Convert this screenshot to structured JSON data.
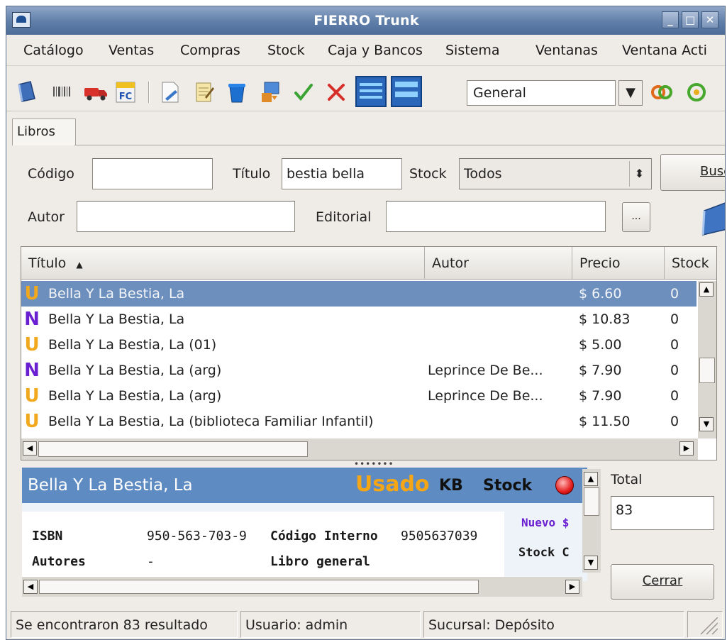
{
  "window": {
    "title": "FIERRO Trunk"
  },
  "menu": [
    "Catálogo",
    "Ventas",
    "Compras",
    "Stock",
    "Caja y Bancos",
    "Sistema",
    "Ventanas",
    "Ventana Acti"
  ],
  "toolbar": {
    "combo_value": "General",
    "icons": [
      "book-icon",
      "barcode-icon",
      "truck-icon",
      "invoice-icon",
      "document-icon",
      "notepad-icon",
      "bin-icon",
      "report-icon",
      "check-icon",
      "cancel-icon",
      "lines-icon",
      "lines-alt-icon"
    ]
  },
  "tabs": {
    "libros": "Libros"
  },
  "search": {
    "codigo_label": "Código",
    "codigo_value": "",
    "titulo_label": "Título",
    "titulo_value": "bestia bella",
    "stock_label": "Stock",
    "stock_value": "Todos",
    "buscar_label": "Busc",
    "autor_label": "Autor",
    "autor_value": "",
    "editorial_label": "Editorial",
    "editorial_value": "",
    "ellipsis_label": "..."
  },
  "results": {
    "columns": [
      "Título",
      "Autor",
      "Precio",
      "Stock"
    ],
    "rows": [
      {
        "badge": "U",
        "titulo": "Bella Y La Bestia, La",
        "autor": "",
        "precio": "$ 6.60",
        "stock": "0"
      },
      {
        "badge": "N",
        "titulo": "Bella Y La Bestia, La",
        "autor": "",
        "precio": "$ 10.83",
        "stock": "0"
      },
      {
        "badge": "U",
        "titulo": "Bella Y La Bestia, La (01)",
        "autor": "",
        "precio": "$ 5.00",
        "stock": "0"
      },
      {
        "badge": "N",
        "titulo": "Bella Y La Bestia, La (arg)",
        "autor": "Leprince De Be...",
        "precio": "$ 7.90",
        "stock": "0"
      },
      {
        "badge": "U",
        "titulo": "Bella Y La Bestia, La (arg)",
        "autor": "Leprince De Be...",
        "precio": "$ 7.90",
        "stock": "0"
      },
      {
        "badge": "U",
        "titulo": "Bella Y La Bestia, La (biblioteca Familiar Infantil)",
        "autor": "",
        "precio": "$ 11.50",
        "stock": "0"
      }
    ]
  },
  "detail": {
    "title": "Bella Y La Bestia, La",
    "usado": "Usado",
    "kb": "KB",
    "stock": "Stock",
    "isbn_label": "ISBN",
    "isbn_value": "950-563-703-9",
    "codigo_interno_label": "Código Interno",
    "codigo_interno_value": "9505637039",
    "autores_label": "Autores",
    "autores_value": "-",
    "libro_general": "Libro general",
    "nuevo": "Nuevo $",
    "stock_c": "Stock C"
  },
  "total": {
    "label": "Total",
    "value": "83"
  },
  "cerrar": "Cerrar",
  "status": {
    "results": "Se encontraron 83 resultado",
    "usuario": "Usuario: admin",
    "sucursal": "Sucursal: Depósito"
  }
}
